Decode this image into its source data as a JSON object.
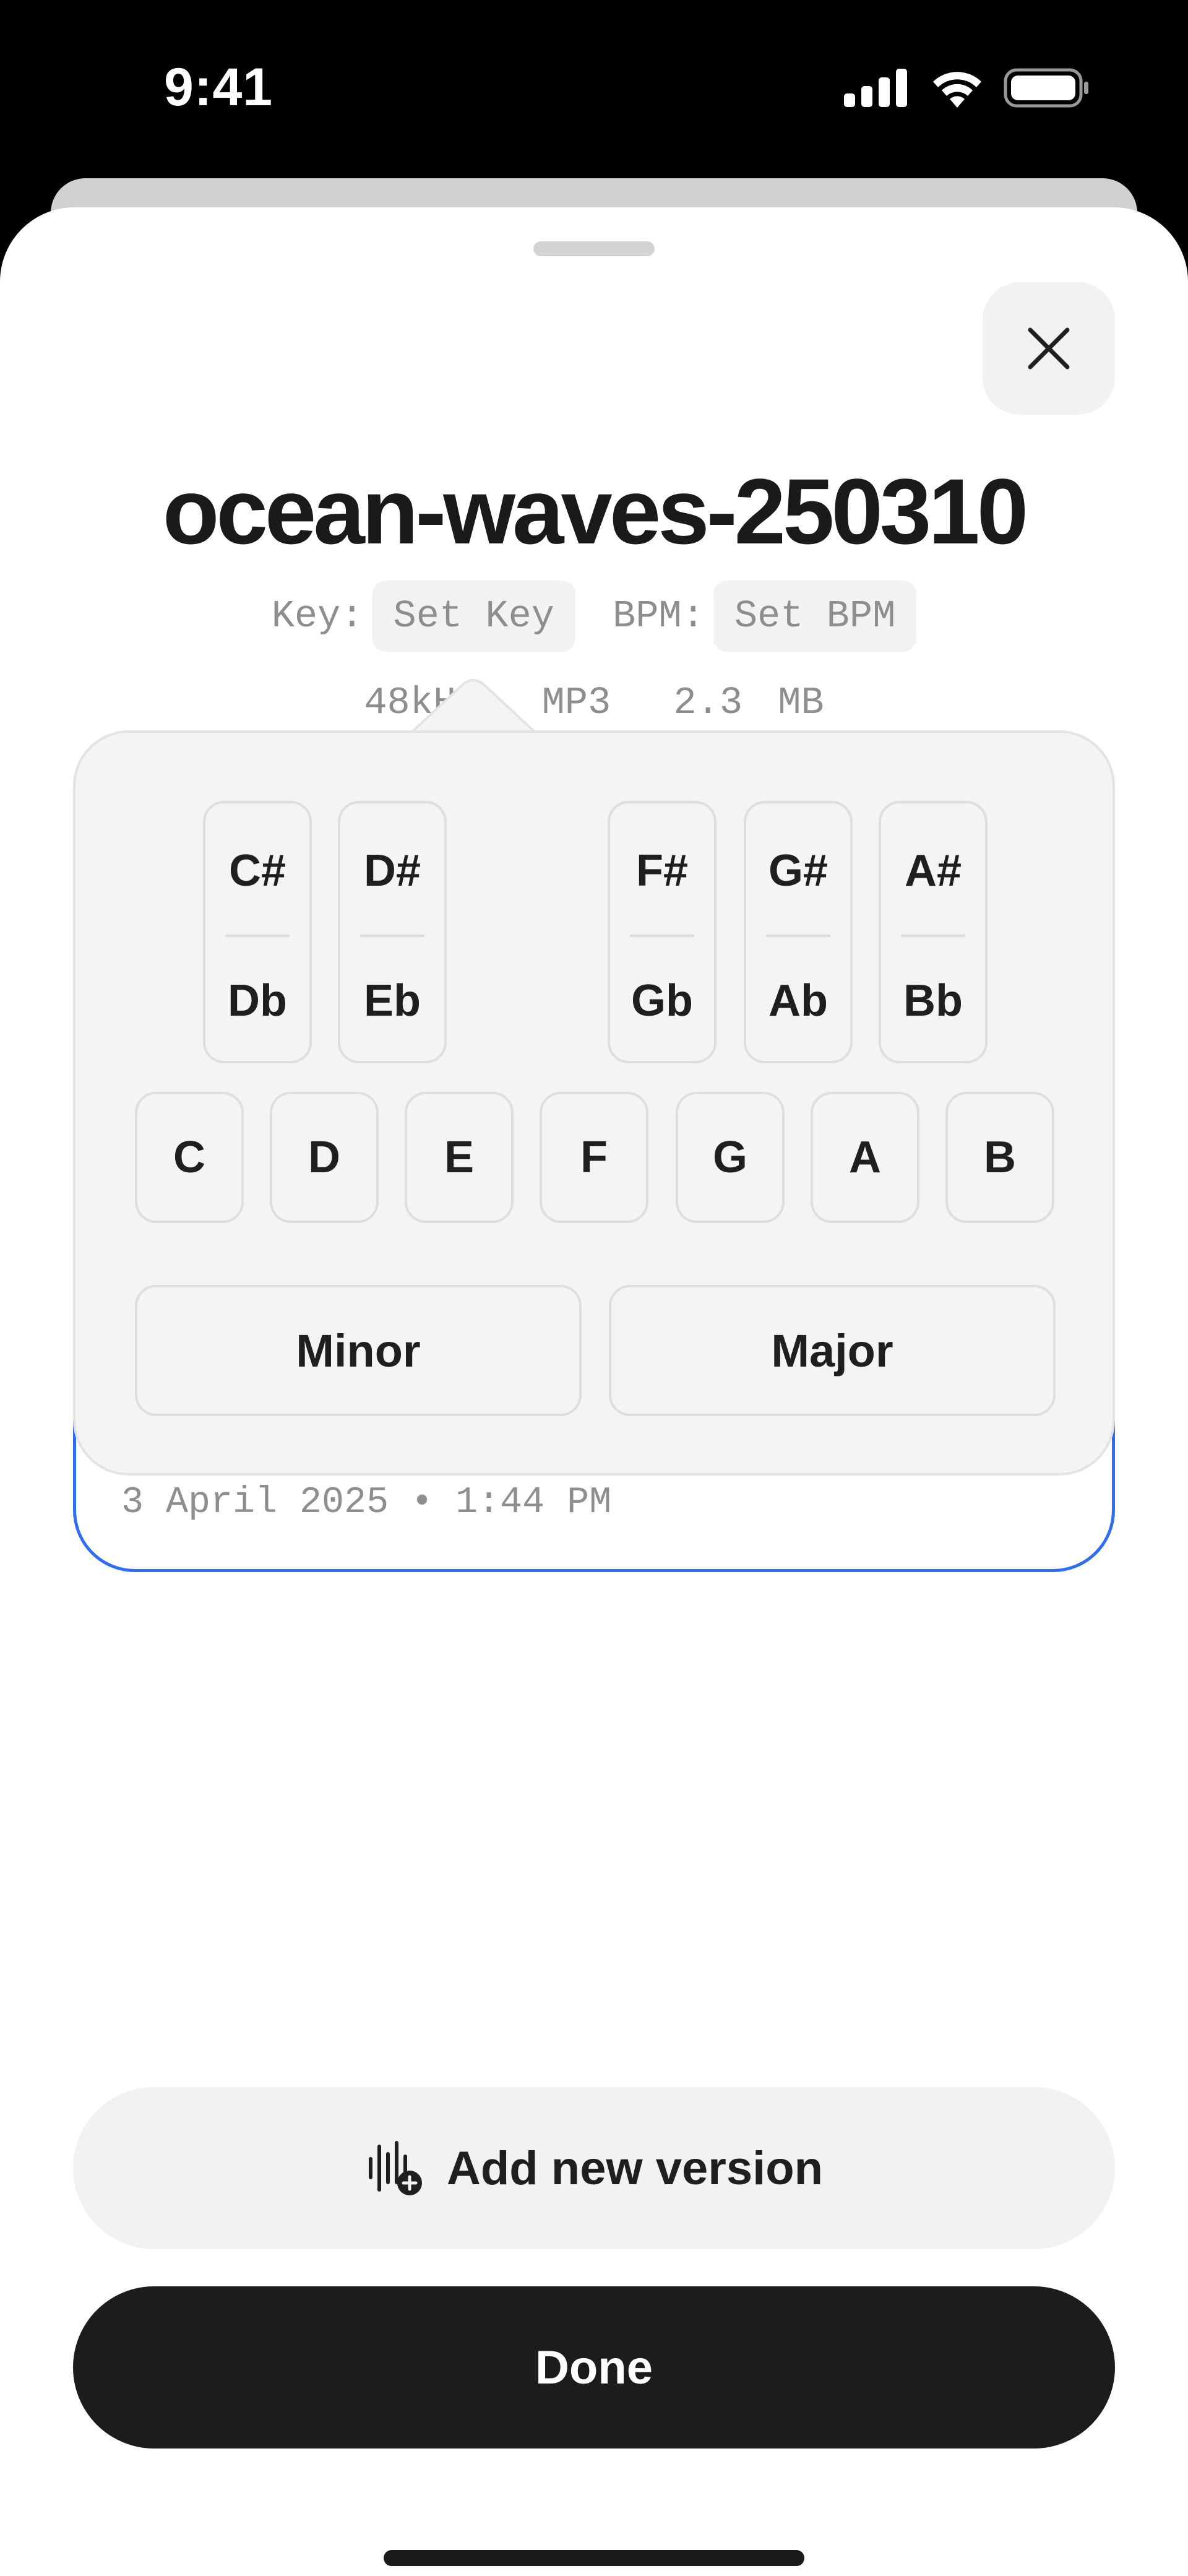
{
  "status_bar": {
    "time": "9:41"
  },
  "sheet": {
    "title": "ocean-waves-250310",
    "key_label": "Key:",
    "key_value": "Set Key",
    "bpm_label": "BPM:",
    "bpm_value": "Set BPM",
    "file_info": [
      "48kHz",
      "MP3",
      "2.3 MB"
    ]
  },
  "key_picker": {
    "black_keys": [
      {
        "sharp": "C#",
        "flat": "Db"
      },
      {
        "sharp": "D#",
        "flat": "Eb"
      },
      {
        "sharp": "F#",
        "flat": "Gb"
      },
      {
        "sharp": "G#",
        "flat": "Ab"
      },
      {
        "sharp": "A#",
        "flat": "Bb"
      }
    ],
    "white_keys": [
      "C",
      "D",
      "E",
      "F",
      "G",
      "A",
      "B"
    ],
    "modes": [
      "Minor",
      "Major"
    ]
  },
  "version": {
    "date": "3 April 2025 • 1:44 PM"
  },
  "actions": {
    "add_version": "Add new version",
    "done": "Done"
  },
  "colors": {
    "accent": "#2f6df6",
    "primary_button": "#1c1c1c",
    "surface": "#f2f2f2"
  },
  "icons": [
    "signal-icon",
    "wifi-icon",
    "battery-icon",
    "close-icon",
    "waveform-plus-icon"
  ]
}
